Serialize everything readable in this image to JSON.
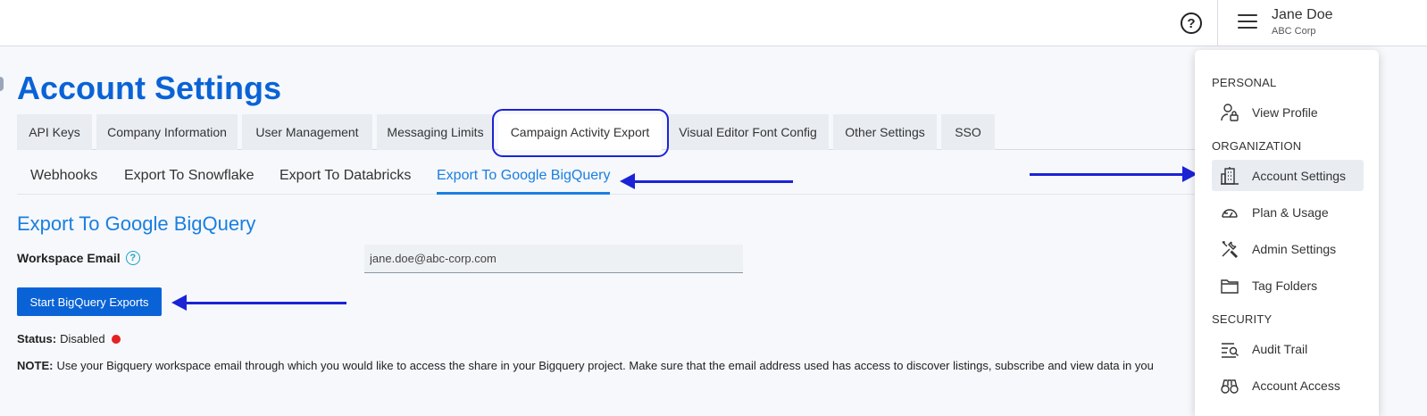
{
  "header": {
    "help_icon": "?",
    "user_name": "Jane Doe",
    "user_company": "ABC Corp"
  },
  "page": {
    "title": "Account Settings"
  },
  "tabs": [
    {
      "label": "API Keys"
    },
    {
      "label": "Company Information"
    },
    {
      "label": "User Management"
    },
    {
      "label": "Messaging Limits"
    },
    {
      "label": "Campaign Activity Export"
    },
    {
      "label": "Visual Editor Font Config"
    },
    {
      "label": "Other Settings"
    },
    {
      "label": "SSO"
    }
  ],
  "subtabs": [
    {
      "label": "Webhooks"
    },
    {
      "label": "Export To Snowflake"
    },
    {
      "label": "Export To Databricks"
    },
    {
      "label": "Export To Google BigQuery"
    }
  ],
  "section": {
    "title": "Export To Google BigQuery",
    "field_label": "Workspace Email",
    "email_value": "jane.doe@abc-corp.com",
    "start_button": "Start BigQuery Exports",
    "status_label": "Status:",
    "status_value": "Disabled",
    "status_color": "#e42222",
    "note_label": "NOTE:",
    "note_text": "Use your Bigquery workspace email through which you would like to access the share in your Bigquery project. Make sure that the email address used has access to discover listings, subscribe and view data in you"
  },
  "menu": {
    "personal_header": "PERSONAL",
    "organization_header": "ORGANIZATION",
    "security_header": "SECURITY",
    "items": [
      {
        "label": "View Profile",
        "icon": "user-lock-icon"
      },
      {
        "label": "Account Settings",
        "icon": "building-icon"
      },
      {
        "label": "Plan & Usage",
        "icon": "gauge-icon"
      },
      {
        "label": "Admin Settings",
        "icon": "tools-icon"
      },
      {
        "label": "Tag Folders",
        "icon": "folder-icon"
      },
      {
        "label": "Audit Trail",
        "icon": "search-list-icon"
      },
      {
        "label": "Account Access",
        "icon": "binoculars-icon"
      }
    ]
  },
  "colors": {
    "brand": "#0a63d6",
    "accent": "#1a7fe0",
    "annotation": "#1b23d6"
  }
}
